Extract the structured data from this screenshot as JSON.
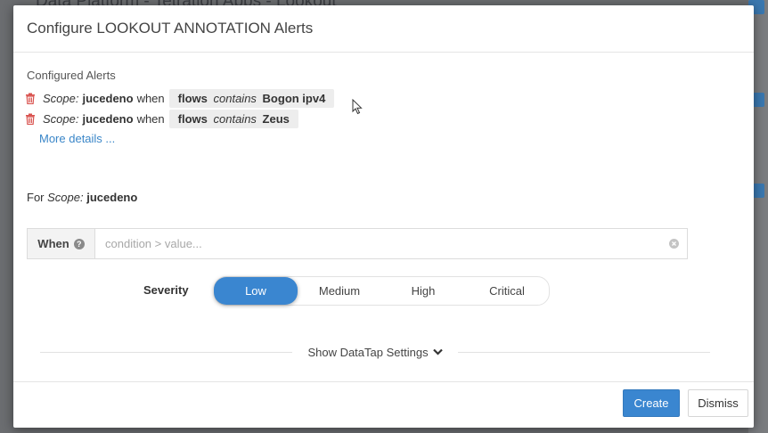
{
  "background": {
    "title_fragment": "Data Platform - Tetration Apps - Lookout"
  },
  "modal": {
    "title": "Configure LOOKOUT ANNOTATION Alerts",
    "configured_label": "Configured Alerts",
    "alerts": [
      {
        "scope_label": "Scope:",
        "scope": "jucedeno",
        "when_label": "when",
        "field": "flows",
        "operator": "contains",
        "value": "Bogon ipv4"
      },
      {
        "scope_label": "Scope:",
        "scope": "jucedeno",
        "when_label": "when",
        "field": "flows",
        "operator": "contains",
        "value": "Zeus"
      }
    ],
    "more_details": "More details ...",
    "for_scope": {
      "prefix": "For",
      "scope_label": "Scope:",
      "scope": "jucedeno"
    },
    "when_field": {
      "label": "When",
      "placeholder": "condition > value...",
      "value": ""
    },
    "severity": {
      "label": "Severity",
      "options": [
        "Low",
        "Medium",
        "High",
        "Critical"
      ],
      "selected": "Low"
    },
    "datatap_toggle": "Show DataTap Settings",
    "buttons": {
      "create": "Create",
      "dismiss": "Dismiss"
    }
  },
  "colors": {
    "primary": "#3a86d0",
    "link": "#3a86c8",
    "trash": "#d9534f"
  }
}
